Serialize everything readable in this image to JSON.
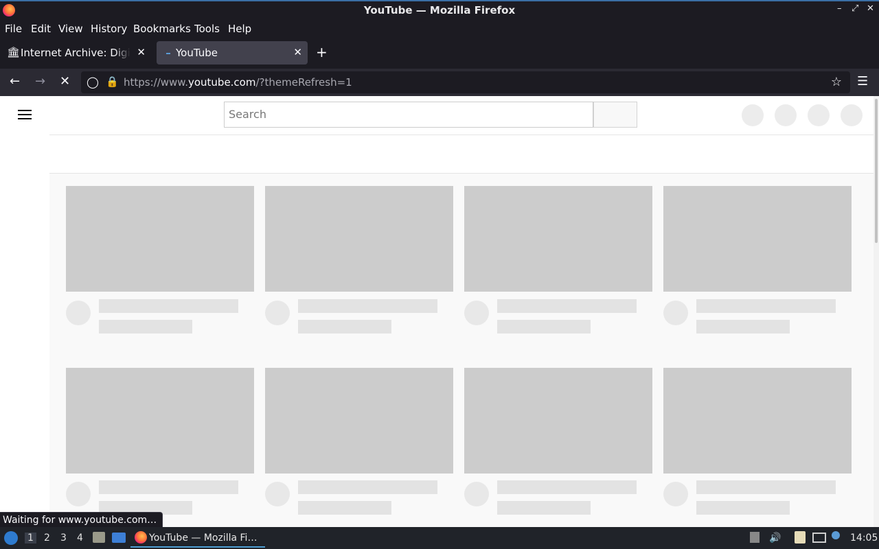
{
  "window": {
    "title": "YouTube — Mozilla Firefox"
  },
  "menu": [
    "File",
    "Edit",
    "View",
    "History",
    "Bookmarks",
    "Tools",
    "Help"
  ],
  "tabs": [
    {
      "label": "Internet Archive: Digital Library",
      "active": false
    },
    {
      "label": "YouTube",
      "active": true
    }
  ],
  "nav": {
    "url_prefix": "https://www.",
    "url_host": "youtube.com",
    "url_rest": "/?themeRefresh=1"
  },
  "page": {
    "search_placeholder": "Search"
  },
  "status": "Waiting for www.youtube.com…",
  "taskbar": {
    "workspaces": [
      "1",
      "2",
      "3",
      "4"
    ],
    "task_label": "YouTube — Mozilla Fi…",
    "clock": "14:05"
  }
}
